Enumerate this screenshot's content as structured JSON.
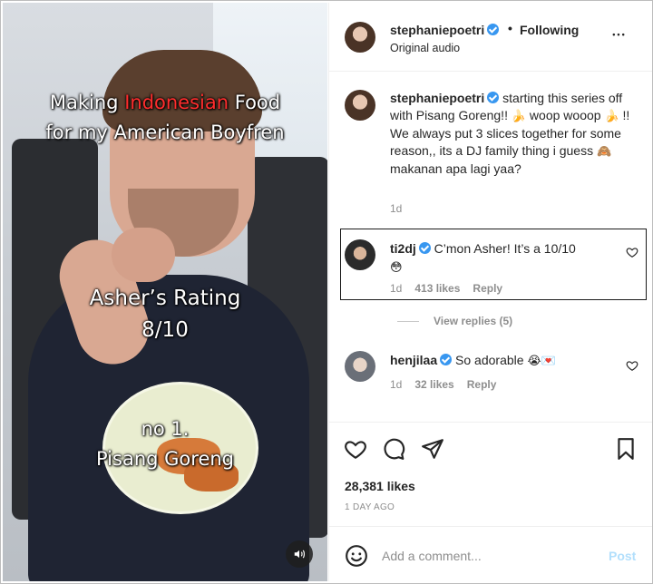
{
  "video": {
    "title_line1_prefix": "Making ",
    "title_line1_accent": "Indonesian",
    "title_line1_suffix": " Food",
    "title_line2": "for my American Boyfren",
    "rating_line1": "Asher’s Rating",
    "rating_line2": "8/10",
    "item_line1": "no 1.",
    "item_line2": "Pisang Goreng",
    "accent_color": "#ff2d2d",
    "sound_icon": "speaker-icon"
  },
  "header": {
    "username": "stephaniepoetri",
    "verified": true,
    "separator": "•",
    "follow_status": "Following",
    "audio": "Original audio",
    "more_icon": "more-horizontal-icon",
    "more_label": "•••"
  },
  "caption": {
    "username": "stephaniepoetri",
    "text_part1": " starting this series off with Pisang Goreng!! ",
    "emoji1": "🍌",
    "text_part2": " woop wooop ",
    "emoji2": "🍌",
    "text_part3": " !! We always put 3 slices together for some reason,, its a DJ family thing i guess ",
    "emoji3": "🙈",
    "text_part4": " makanan apa lagi yaa?",
    "time": "1d"
  },
  "comments": [
    {
      "username": "ti2dj",
      "verified": true,
      "text": " C’mon Asher! It’s a 10/10",
      "emoji": "😳",
      "time": "1d",
      "likes": "413 likes",
      "reply": "Reply",
      "highlighted": true
    },
    {
      "username": "henjilaa",
      "verified": true,
      "text": " So adorable ",
      "emoji": "😭💌",
      "time": "1d",
      "likes": "32 likes",
      "reply": "Reply"
    }
  ],
  "view_replies": "View replies (5)",
  "actions": {
    "likes": "28,381 likes",
    "date": "1 DAY AGO",
    "icons": [
      "heart-icon",
      "comment-icon",
      "share-icon",
      "bookmark-icon"
    ]
  },
  "composer": {
    "placeholder": "Add a comment...",
    "post_label": "Post",
    "post_color": "#b2dffc",
    "emoji_icon": "smiley-icon"
  },
  "colors": {
    "verified": "#3897f0",
    "text": "#262626",
    "muted": "#8e8e8e"
  }
}
